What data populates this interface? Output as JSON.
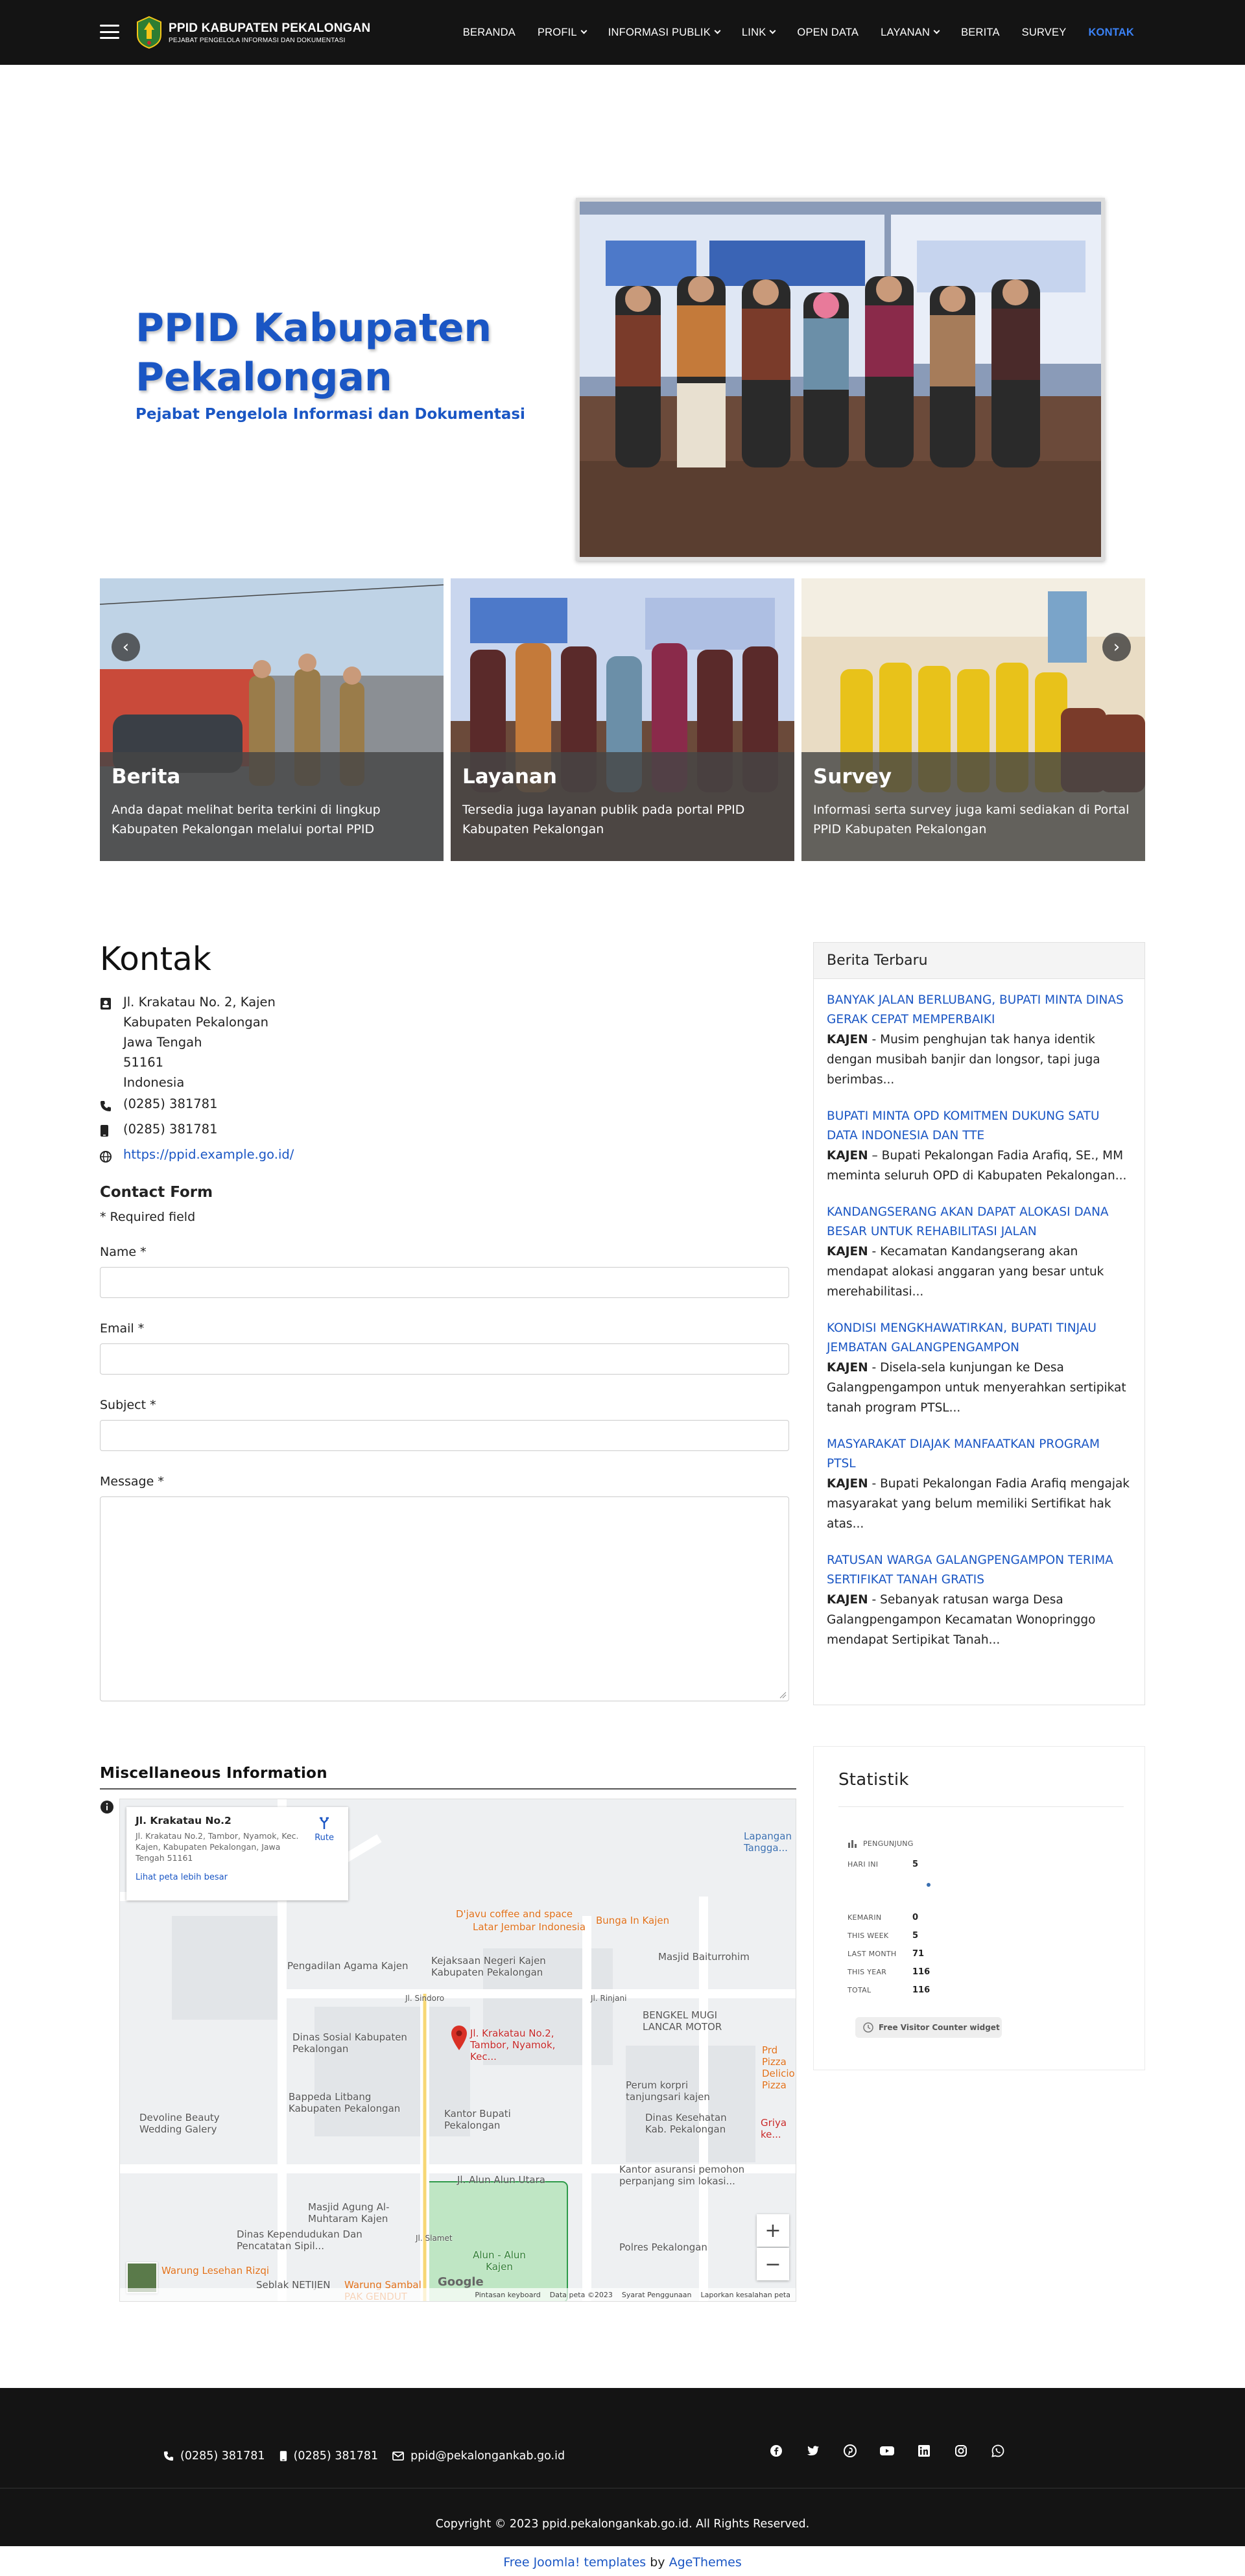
{
  "navbar": {
    "brand_title": "PPID KABUPATEN PEKALONGAN",
    "brand_subtitle": "PEJABAT PENGELOLA INFORMASI DAN DOKUMENTASI",
    "menu": [
      {
        "label": "BERANDA",
        "dropdown": false,
        "active": false
      },
      {
        "label": "PROFIL",
        "dropdown": true,
        "active": false
      },
      {
        "label": "INFORMASI PUBLIK",
        "dropdown": true,
        "active": false
      },
      {
        "label": "LINK",
        "dropdown": true,
        "active": false
      },
      {
        "label": "OPEN DATA",
        "dropdown": false,
        "active": false
      },
      {
        "label": "LAYANAN",
        "dropdown": true,
        "active": false
      },
      {
        "label": "BERITA",
        "dropdown": false,
        "active": false
      },
      {
        "label": "SURVEY",
        "dropdown": false,
        "active": false
      },
      {
        "label": "KONTAK",
        "dropdown": false,
        "active": true
      }
    ]
  },
  "hero": {
    "title": "PPID Kabupaten Pekalongan",
    "subtitle": "Pejabat Pengelola Informasi dan Dokumentasi"
  },
  "cards": [
    {
      "title": "Berita",
      "text": "Anda dapat melihat berita terkini di lingkup Kabupaten Pekalongan melalui portal PPID"
    },
    {
      "title": "Layanan",
      "text": "Tersedia juga layanan publik pada portal PPID Kabupaten Pekalongan"
    },
    {
      "title": "Survey",
      "text": "Informasi serta survey juga kami sediakan di Portal PPID Kabupaten Pekalongan"
    }
  ],
  "carousel": {
    "prev_icon": "‹",
    "next_icon": "›"
  },
  "contact": {
    "heading": "Kontak",
    "address_lines": [
      "Jl. Krakatau No. 2, Kajen",
      "Kabupaten Pekalongan",
      "Jawa Tengah",
      "51161",
      "Indonesia"
    ],
    "phone": "(0285) 381781",
    "mobile": "(0285) 381781",
    "website": "https://ppid.example.go.id/",
    "form_title": "Contact Form",
    "required_note": "* Required field",
    "fields": {
      "name": "Name *",
      "email": "Email *",
      "subject": "Subject *",
      "message": "Message *"
    }
  },
  "sidebar": {
    "heading": "Berita Terbaru",
    "news": [
      {
        "title": "BANYAK JALAN BERLUBANG, BUPATI MINTA DINAS GERAK CEPAT MEMPERBAIKI",
        "place": "KAJEN",
        "body": " - Musim penghujan tak hanya identik dengan musibah banjir dan longsor, tapi juga berimbas..."
      },
      {
        "title": "BUPATI MINTA OPD KOMITMEN DUKUNG SATU DATA INDONESIA DAN TTE",
        "place": "KAJEN",
        "body": " – Bupati Pekalongan Fadia Arafiq, SE., MM meminta seluruh OPD di Kabupaten Pekalongan..."
      },
      {
        "title": "KANDANGSERANG AKAN DAPAT ALOKASI DANA BESAR UNTUK REHABILITASI JALAN",
        "place": "KAJEN",
        "body": " - Kecamatan Kandangserang akan mendapat alokasi anggaran yang besar untuk merehabilitasi..."
      },
      {
        "title": "KONDISI MENGKHAWATIRKAN, BUPATI TINJAU JEMBATAN GALANGPENGAMPON",
        "place": "KAJEN",
        "body": " - Disela-sela kunjungan ke Desa Galangpengampon untuk menyerahkan sertipikat tanah program PTSL..."
      },
      {
        "title": "MASYARAKAT DIAJAK MANFAATKAN PROGRAM PTSL",
        "place": "KAJEN",
        "body": " - Bupati Pekalongan Fadia Arafiq mengajak masyarakat yang belum memiliki Sertifikat hak atas..."
      },
      {
        "title": "RATUSAN WARGA GALANGPENGAMPON TERIMA SERTIFIKAT TANAH GRATIS",
        "place": "KAJEN",
        "body": " - Sebanyak ratusan warga Desa Galangpengampon Kecamatan Wonopringgo mendapat Sertipikat Tanah..."
      }
    ]
  },
  "misc": {
    "heading": "Miscellaneous Information",
    "map": {
      "card_title": "Jl. Krakatau No.2",
      "card_address": "Jl. Krakatau No.2, Tambor, Nyamok, Kec. Kajen, Kabupaten Pekalongan, Jawa Tengah 51161",
      "card_link": "Lihat peta lebih besar",
      "route": "Rute",
      "pin_label": "Jl. Krakatau No.2, Tambor, Nyamok, Kec...",
      "google": "Google",
      "footer_items": [
        "Pintasan keyboard",
        "Data peta ©2023",
        "Syarat Penggunaan",
        "Laporkan kesalahan peta"
      ],
      "places": [
        {
          "name": "Lapangan Tangga..."
        },
        {
          "name": "Bunga In Kajen"
        },
        {
          "name": "D'javu coffee and space"
        },
        {
          "name": "Latar Jembar Indonesia"
        },
        {
          "name": "Masjid Baiturrohim"
        },
        {
          "name": "Pengadilan Agama Kajen"
        },
        {
          "name": "Kejaksaan Negeri Kajen Kabupaten Pekalongan"
        },
        {
          "name": "BENGKEL MUGI LANCAR MOTOR"
        },
        {
          "name": "Dinas Sosial Kabupaten Pekalongan"
        },
        {
          "name": "Prd Pizza Delicious Pizza"
        },
        {
          "name": "Bappeda Litbang Kabupaten Pekalongan"
        },
        {
          "name": "Devoline Beauty Wedding Galery"
        },
        {
          "name": "Kantor Bupati Pekalongan"
        },
        {
          "name": "Perum korpri tanjungsari kajen"
        },
        {
          "name": "Dinas Kesehatan Kab. Pekalongan"
        },
        {
          "name": "Griya ke..."
        },
        {
          "name": "Jl. Alun Alun Utara"
        },
        {
          "name": "Kantor asuransi pemohon perpanjang sim lokasi..."
        },
        {
          "name": "Masjid Agung Al-Muhtaram Kajen"
        },
        {
          "name": "Dinas Kependudukan Dan Pencatatan Sipil..."
        },
        {
          "name": "Alun - Alun Kajen"
        },
        {
          "name": "Polres Pekalongan"
        },
        {
          "name": "Warung Lesehan Rizqi"
        },
        {
          "name": "Seblak NETIJEN"
        },
        {
          "name": "Warung Sambal PAK GENDUT"
        },
        {
          "name": "Jl. Sindoro"
        },
        {
          "name": "Jl. Rinjani"
        },
        {
          "name": "Jl. Slamet"
        }
      ]
    }
  },
  "stats": {
    "heading": "Statistik",
    "chart_label": "PENGUNJUNG",
    "today_label": "HARI INI",
    "today_value": "5",
    "rows": [
      {
        "label": "KEMARIN",
        "value": "0"
      },
      {
        "label": "THIS WEEK",
        "value": "5"
      },
      {
        "label": "LAST MONTH",
        "value": "71"
      },
      {
        "label": "THIS YEAR",
        "value": "116"
      },
      {
        "label": "TOTAL",
        "value": "116"
      }
    ],
    "badge": "Free Visitor Counter widget"
  },
  "footer": {
    "phone": "(0285) 381781",
    "mobile": "(0285) 381781",
    "email": "ppid@pekalongankab.go.id",
    "socials": [
      "facebook-icon",
      "twitter-icon",
      "pinterest-icon",
      "youtube-icon",
      "linkedin-icon",
      "instagram-icon",
      "whatsapp-icon"
    ],
    "copyright": "Copyright © 2023 ppid.pekalongankab.go.id. All Rights Reserved."
  },
  "credit": {
    "link_text": "Free Joomla! templates",
    "by": "by",
    "author": "AgeThemes"
  },
  "colors": {
    "accent": "#1a56c4",
    "nav_bg": "#141414",
    "active_menu": "#3b82f6"
  }
}
